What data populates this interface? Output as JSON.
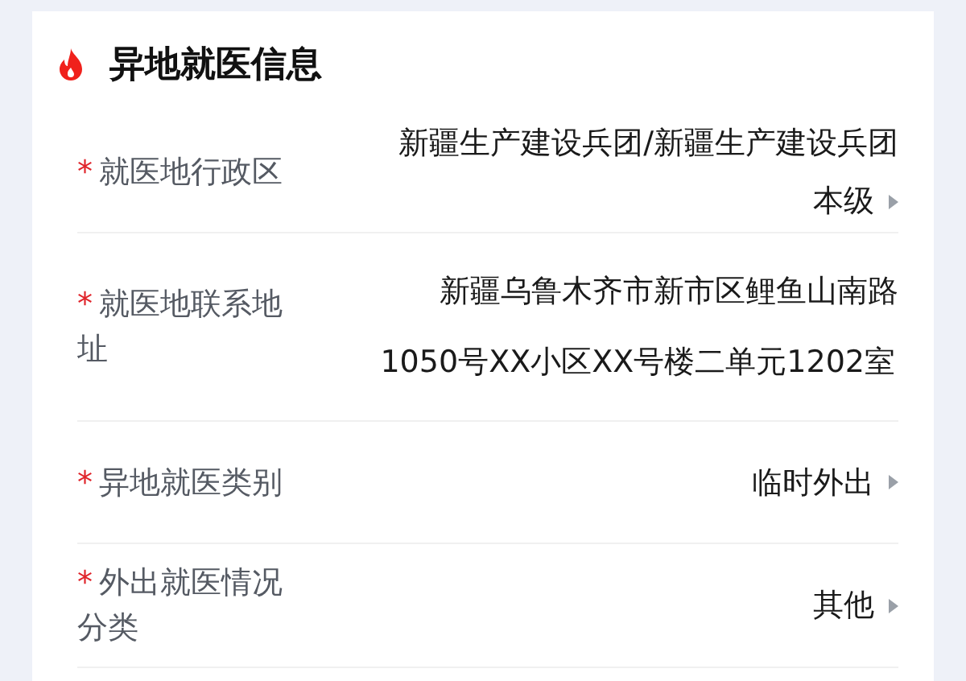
{
  "section": {
    "title": "异地就医信息"
  },
  "fields": [
    {
      "kind": "select",
      "mark": "*",
      "label": "就医地行政区",
      "value_lines": [
        "新疆生产建设兵团/新疆生产建设兵团",
        "本级"
      ]
    },
    {
      "kind": "text",
      "mark": "*",
      "label": "就医地联系地址",
      "value_lines": [
        "新疆乌鲁木齐市新市区鲤鱼山南路",
        "1050号XX小区XX号楼二单元1202室"
      ]
    },
    {
      "kind": "select",
      "mark": "*",
      "label": "异地就医类别",
      "value_lines": [
        "临时外出"
      ]
    },
    {
      "kind": "select",
      "mark": "*",
      "label": "外出就医情况分类",
      "value_lines": [
        "其他"
      ]
    }
  ]
}
